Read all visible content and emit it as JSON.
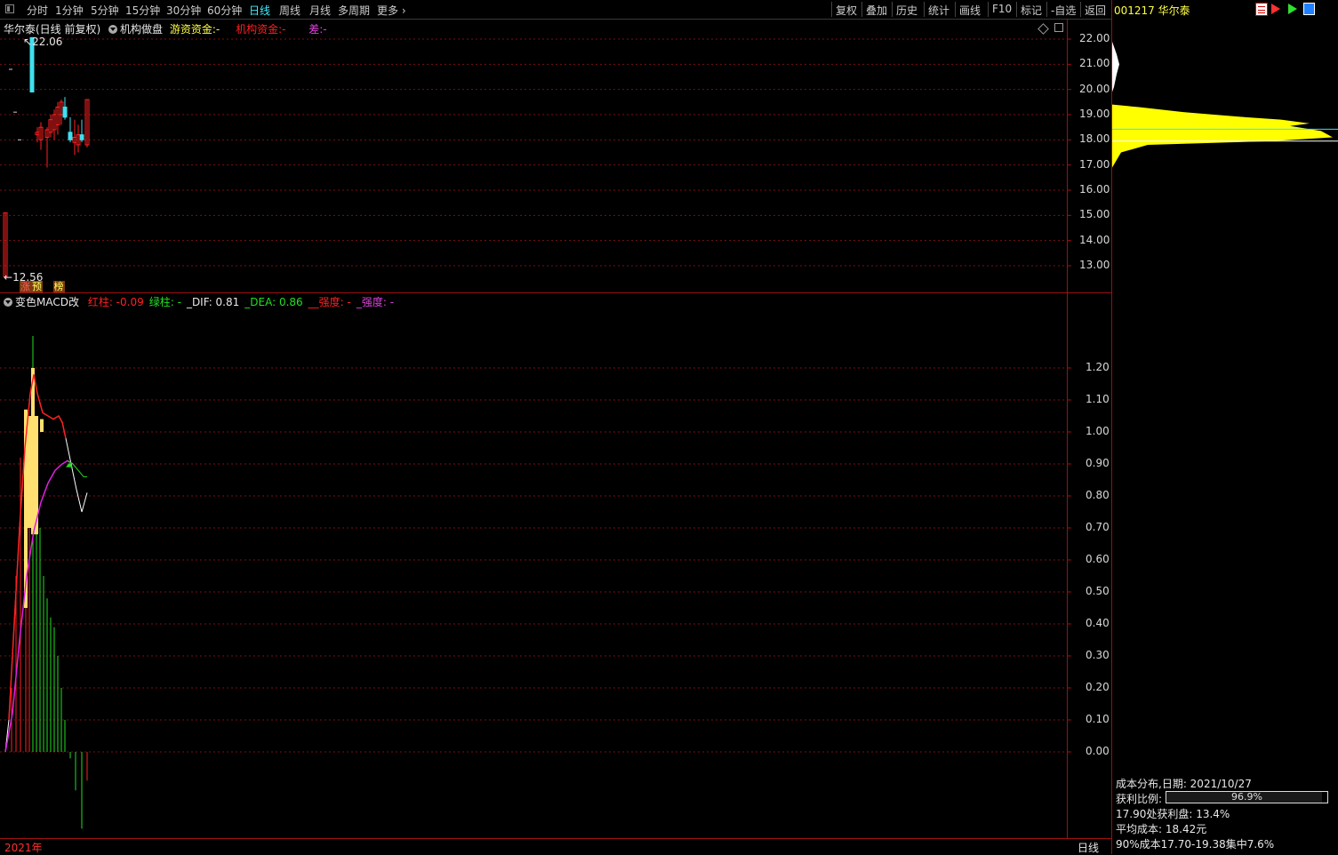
{
  "toolbar": {
    "periods": [
      "分时",
      "1分钟",
      "5分钟",
      "15分钟",
      "30分钟",
      "60分钟",
      "日线",
      "周线",
      "月线",
      "多周期",
      "更多"
    ],
    "active_period": "日线",
    "right_buttons": [
      "复权",
      "叠加",
      "历史",
      "统计",
      "画线",
      "F10",
      "标记",
      "-自选",
      "返回"
    ]
  },
  "main_chart": {
    "title": "华尔泰(日线 前复权)",
    "indicator_name": "机构做盘",
    "legend": [
      {
        "label": "游资资金:-",
        "color": "#ffff44"
      },
      {
        "label": "机构资金:-",
        "color": "#ff2020"
      },
      {
        "label": "差:-",
        "color": "#e040e0"
      }
    ],
    "price_axis": [
      "22.00",
      "21.00",
      "20.00",
      "19.00",
      "18.00",
      "17.00",
      "16.00",
      "15.00",
      "14.00",
      "13.00"
    ],
    "high_marker": "22.06",
    "low_marker": "12.56",
    "badges": [
      "涨",
      "预",
      "榜"
    ],
    "candles": [
      {
        "o": 12.56,
        "h": 15.1,
        "l": 12.56,
        "c": 15.1
      },
      {
        "o": 22.06,
        "h": 22.06,
        "l": 19.9,
        "c": 19.9
      },
      {
        "o": 18.2,
        "h": 18.5,
        "l": 17.9,
        "c": 18.3
      },
      {
        "o": 18.0,
        "h": 18.7,
        "l": 17.6,
        "c": 18.5
      },
      {
        "o": 18.1,
        "h": 18.5,
        "l": 16.9,
        "c": 18.4
      },
      {
        "o": 18.3,
        "h": 19.0,
        "l": 18.1,
        "c": 18.8
      },
      {
        "o": 18.4,
        "h": 19.2,
        "l": 18.0,
        "c": 19.0
      },
      {
        "o": 18.6,
        "h": 19.5,
        "l": 18.2,
        "c": 19.3
      },
      {
        "o": 19.0,
        "h": 19.6,
        "l": 18.6,
        "c": 19.5
      },
      {
        "o": 19.3,
        "h": 19.7,
        "l": 18.8,
        "c": 18.9
      },
      {
        "o": 18.3,
        "h": 18.9,
        "l": 17.9,
        "c": 18.0
      },
      {
        "o": 17.9,
        "h": 18.8,
        "l": 17.4,
        "c": 18.1
      },
      {
        "o": 17.8,
        "h": 18.6,
        "l": 17.5,
        "c": 18.2
      },
      {
        "o": 18.2,
        "h": 18.8,
        "l": 17.9,
        "c": 18.0
      },
      {
        "o": 17.8,
        "h": 19.6,
        "l": 17.7,
        "c": 19.6
      }
    ]
  },
  "macd_chart": {
    "indicator_name": "变色MACD改",
    "legend": [
      {
        "label": "红柱:",
        "value": "-0.09",
        "color": "#ff2020"
      },
      {
        "label": "绿柱:",
        "value": "-",
        "color": "#20e020"
      },
      {
        "label": "_DIF:",
        "value": "0.81",
        "color": "#e8e8e8"
      },
      {
        "label": "_DEA:",
        "value": "0.86",
        "color": "#20e020"
      },
      {
        "label": "__强度:",
        "value": "-",
        "color": "#ff2020"
      },
      {
        "label": "_强度:",
        "value": "-",
        "color": "#e040e0"
      }
    ],
    "axis": [
      "1.20",
      "1.10",
      "1.00",
      "0.90",
      "0.80",
      "0.70",
      "0.60",
      "0.50",
      "0.40",
      "0.30",
      "0.20",
      "0.10",
      "0.00"
    ]
  },
  "bottom_bar": {
    "year": "2021年",
    "period": "日线"
  },
  "sidebar": {
    "code_name": "001217 华尔泰",
    "cost_distribution_label": "成本分布,日期: 2021/10/27",
    "profit_ratio_label": "获利比例:",
    "profit_ratio_value": "96.9%",
    "profit_ratio": 0.969,
    "line1": "17.90处获利盘: 13.4%",
    "line2": "平均成本: 18.42元",
    "line3": "90%成本17.70-19.38集中7.6%"
  },
  "colors": {
    "up": "#ff2020",
    "down": "#40e0f0",
    "grid": "#7a1010",
    "chip_yellow": "#ffff00",
    "chip_white": "#ffffff"
  }
}
